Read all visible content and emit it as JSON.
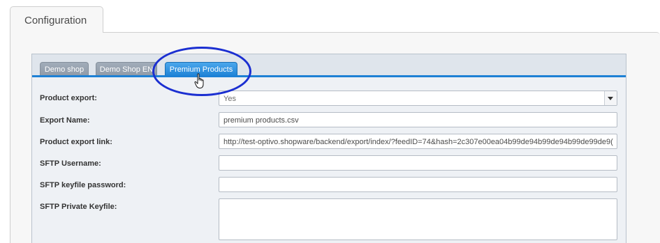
{
  "outer_tab": {
    "label": "Configuration"
  },
  "shop_tabs": [
    {
      "label": "Demo shop",
      "active": false
    },
    {
      "label": "Demo Shop EN",
      "active": false
    },
    {
      "label": "Premium Products",
      "active": true
    }
  ],
  "form": {
    "product_export": {
      "label": "Product export:",
      "value": "Yes"
    },
    "export_name": {
      "label": "Export Name:",
      "value": "premium products.csv"
    },
    "product_export_link": {
      "label": "Product export link:",
      "value": "http://test-optivo.shopware/backend/export/index/?feedID=74&hash=2c307e00ea04b99de94b99de94b99de99de9( "
    },
    "sftp_username": {
      "label": "SFTP Username:",
      "value": ""
    },
    "sftp_keyfile_password": {
      "label": "SFTP keyfile password:",
      "value": ""
    },
    "sftp_private_keyfile": {
      "label": "SFTP Private Keyfile:",
      "value": ""
    }
  },
  "colors": {
    "active_tab": "#1d81d5",
    "annotation_circle": "#1b2fd1"
  },
  "icons": {
    "cursor": "hand-pointer-icon",
    "dropdown": "chevron-down-icon"
  }
}
